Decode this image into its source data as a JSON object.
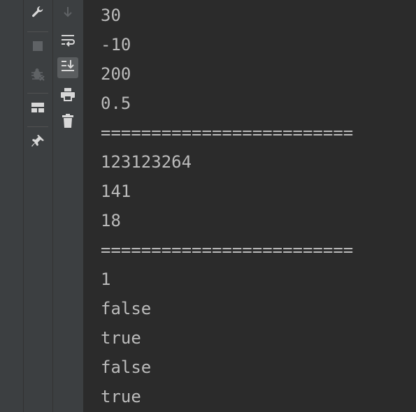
{
  "icons": {
    "settings": "wrench-icon",
    "stop": "stop-icon",
    "debug": "debug-icon",
    "layout": "layout-icon",
    "pin": "pin-icon",
    "scroll_down": "arrow-down-icon",
    "soft_wrap": "soft-wrap-icon",
    "scroll_to_end": "scroll-to-end-icon",
    "print": "print-icon",
    "clear": "trash-icon"
  },
  "colors": {
    "background": "#2b2b2b",
    "toolbar": "#3c3f41",
    "text": "#bbbbbb",
    "active_button": "#5a5d5f"
  },
  "console": {
    "lines": [
      "30",
      "-10",
      "200",
      "0.5",
      "=========================",
      "123123264",
      "141",
      "18",
      "=========================",
      "1",
      "false",
      "true",
      "false",
      "true"
    ]
  }
}
